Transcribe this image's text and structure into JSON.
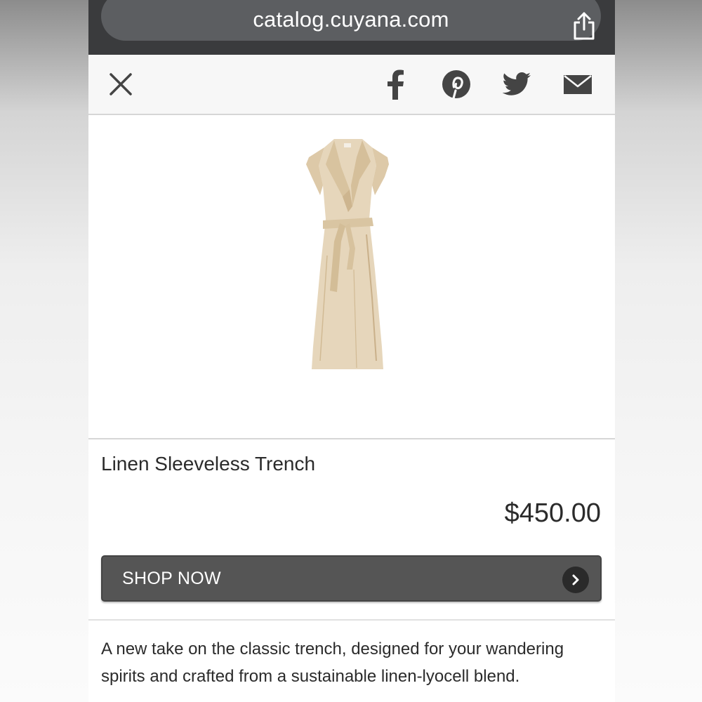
{
  "browser": {
    "url": "catalog.cuyana.com",
    "share_icon": "share-icon"
  },
  "share_bar": {
    "close_icon": "close-icon",
    "social_icons": [
      "facebook-icon",
      "pinterest-icon",
      "twitter-icon",
      "email-icon"
    ]
  },
  "product": {
    "image_alt": "dress-image",
    "title": "Linen Sleeveless Trench",
    "price": "$450.00",
    "shop_button_label": "SHOP NOW",
    "description": "A new take on the classic trench, designed for your wandering spirits and crafted from a sustainable linen-lyocell blend."
  },
  "colors": {
    "browser_bar": "#3a3b3d",
    "url_pill": "#5c5e61",
    "button": "#555555",
    "dress": "#e6d6bb",
    "icons": "#444444"
  }
}
